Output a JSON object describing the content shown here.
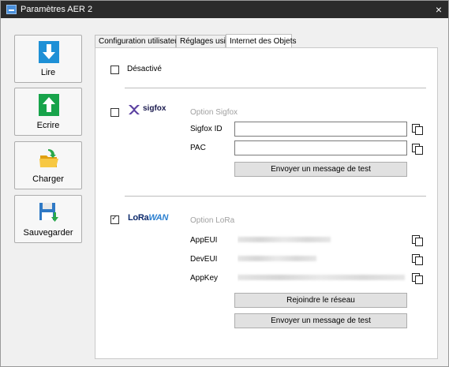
{
  "window": {
    "title": "Paramètres AER 2",
    "close_label": "×"
  },
  "sidebar": {
    "read_label": "Lire",
    "write_label": "Ecrire",
    "load_label": "Charger",
    "save_label": "Sauvegarder"
  },
  "tabs": [
    {
      "label": "Configuration utilisateur"
    },
    {
      "label": "Réglages usine"
    },
    {
      "label": "Internet des Objets",
      "active": true
    }
  ],
  "iot": {
    "disabled_label": "Désactivé",
    "disabled_checked": false,
    "sigfox": {
      "checked": false,
      "logo_text": "sigfox",
      "section_label": "Option Sigfox",
      "id_label": "Sigfox ID",
      "id_value": "",
      "pac_label": "PAC",
      "pac_value": "",
      "test_button": "Envoyer un message de test"
    },
    "lora": {
      "checked": true,
      "logo_text_main": "LoRa",
      "logo_text_accent": "WAN",
      "section_label": "Option LoRa",
      "appeui_label": "AppEUI",
      "deveui_label": "DevEUI",
      "appkey_label": "AppKey",
      "join_button": "Rejoindre le réseau",
      "test_button": "Envoyer un message de test"
    }
  },
  "colors": {
    "titlebar": "#2b2b2b",
    "accent_blue": "#1e90d6",
    "accent_green": "#17a34a",
    "folder_yellow": "#f2b51c"
  }
}
